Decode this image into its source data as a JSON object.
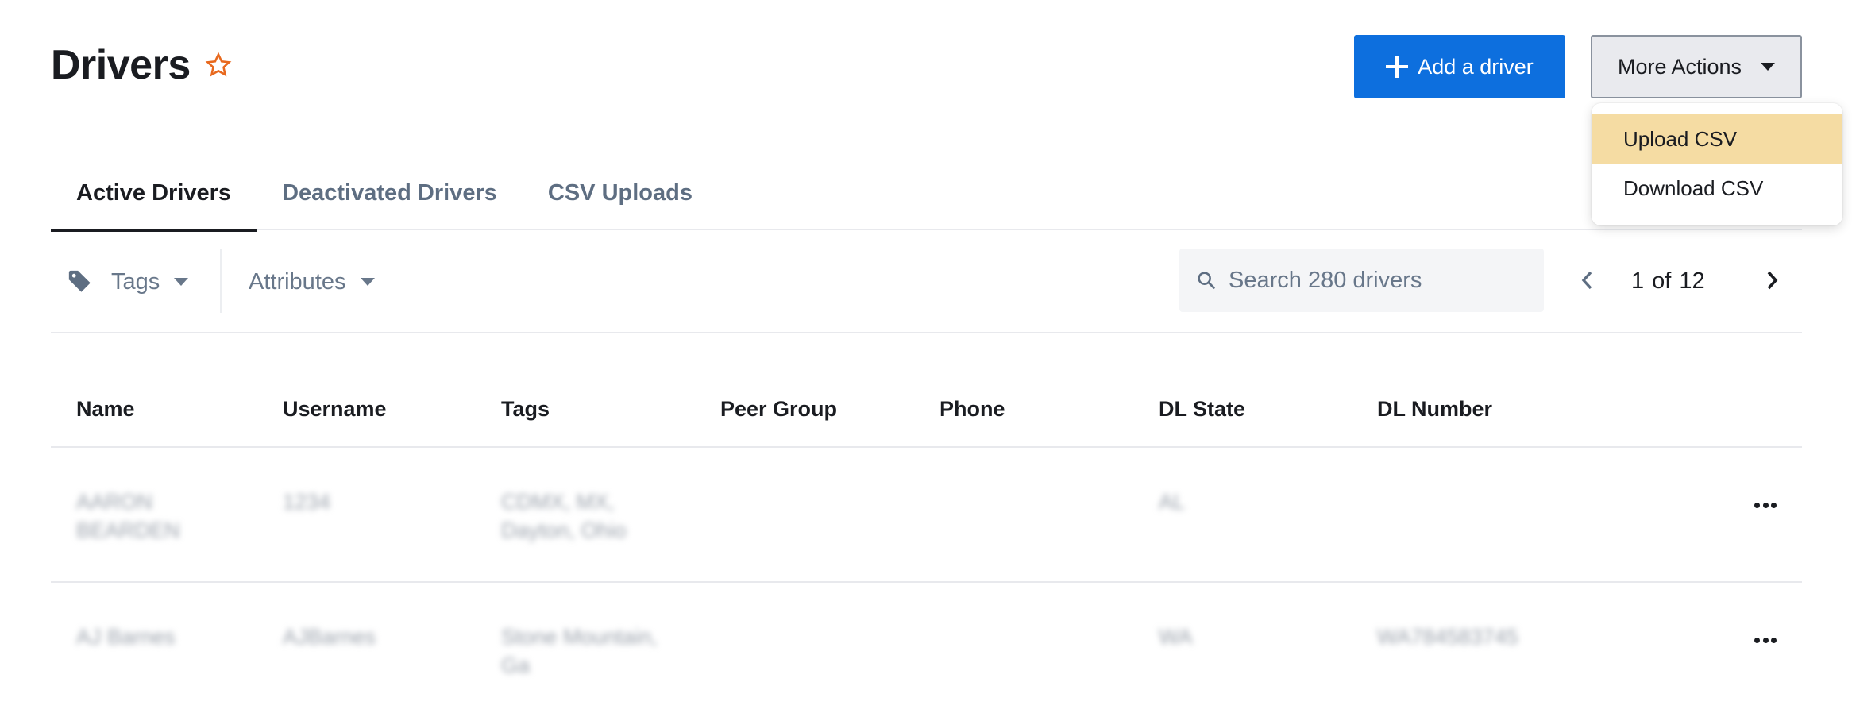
{
  "header": {
    "title": "Drivers",
    "favorite_icon": "star-outline-icon",
    "add_button_label": "Add a driver",
    "more_actions_label": "More Actions"
  },
  "more_actions_menu": {
    "items": [
      {
        "label": "Upload CSV",
        "highlighted": true
      },
      {
        "label": "Download CSV",
        "highlighted": false
      }
    ]
  },
  "tabs": [
    {
      "label": "Active Drivers",
      "active": true
    },
    {
      "label": "Deactivated Drivers",
      "active": false
    },
    {
      "label": "CSV Uploads",
      "active": false
    }
  ],
  "filters": {
    "tags_label": "Tags",
    "tags_icon": "tag-icon",
    "attributes_label": "Attributes"
  },
  "search": {
    "placeholder": "Search 280 drivers",
    "value": ""
  },
  "pagination": {
    "current": "1",
    "of_label": "of",
    "total": "12"
  },
  "table": {
    "columns": [
      "Name",
      "Username",
      "Tags",
      "Peer Group",
      "Phone",
      "DL State",
      "DL Number"
    ],
    "rows": [
      {
        "name": "AARON BEARDEN",
        "username": "1234",
        "tags": "CDMX, MX, Dayton, Ohio",
        "peer_group": "",
        "phone": "",
        "dl_state": "AL",
        "dl_number": ""
      },
      {
        "name": "AJ Barnes",
        "username": "AJBarnes",
        "tags": "Stone Mountain, Ga",
        "peer_group": "",
        "phone": "",
        "dl_state": "WA",
        "dl_number": "WA784583745"
      }
    ]
  },
  "colors": {
    "primary": "#0d6fde",
    "star": "#e8691e",
    "menu_highlight": "#f5dca3",
    "muted_text": "#5e6e82"
  }
}
